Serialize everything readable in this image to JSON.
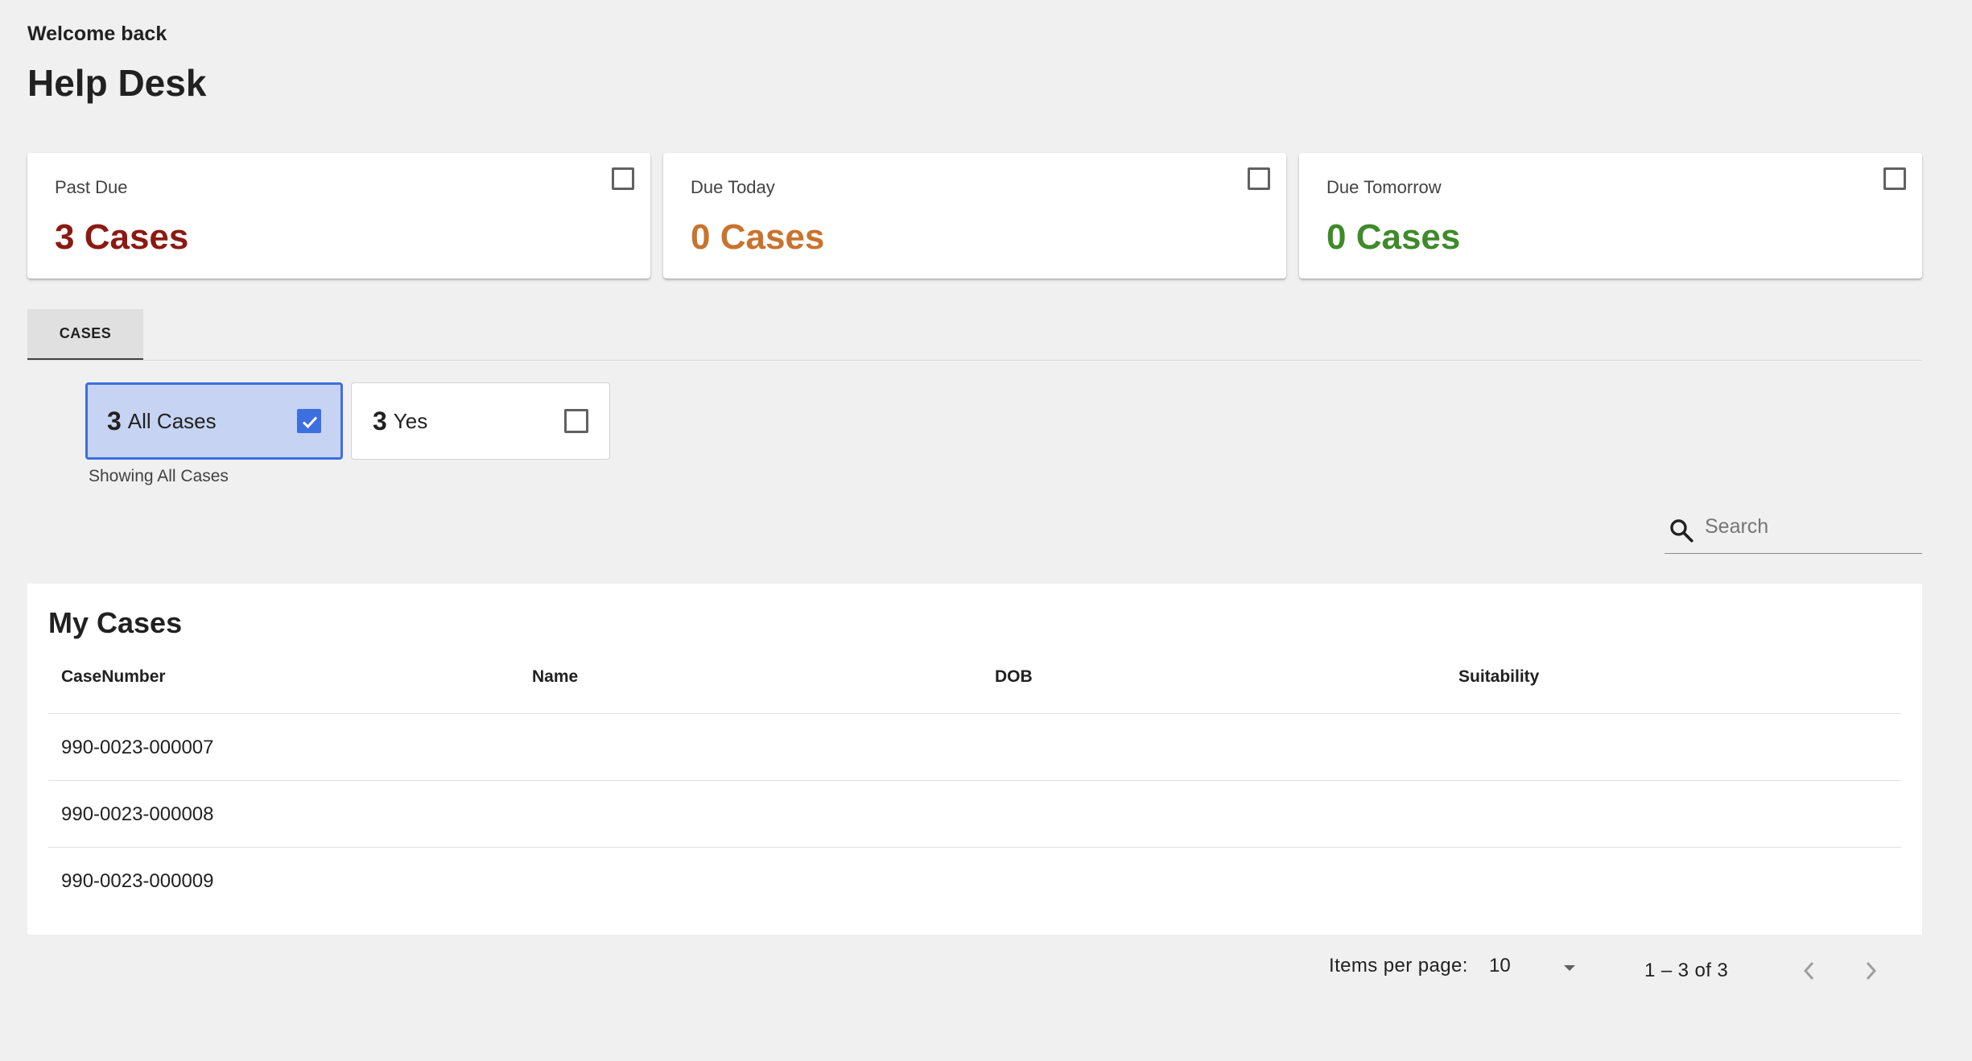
{
  "header": {
    "welcome": "Welcome back",
    "title": "Help Desk"
  },
  "summary_cards": [
    {
      "label": "Past Due",
      "count": "3 Cases",
      "color": "#8b1a12"
    },
    {
      "label": "Due Today",
      "count": "0 Cases",
      "color": "#c8732e"
    },
    {
      "label": "Due Tomorrow",
      "count": "0 Cases",
      "color": "#3f8a2a"
    }
  ],
  "tabs": [
    {
      "label": "CASES",
      "active": true
    }
  ],
  "filters": [
    {
      "count": "3",
      "label": "All Cases",
      "checked": true
    },
    {
      "count": "3",
      "label": "Yes",
      "checked": false
    }
  ],
  "filter_status": "Showing All Cases",
  "search": {
    "placeholder": "Search",
    "icon": "search-icon"
  },
  "cases_table": {
    "title": "My Cases",
    "columns": [
      "CaseNumber",
      "Name",
      "DOB",
      "Suitability"
    ],
    "rows": [
      {
        "case_number": "990-0023-000007",
        "name": "",
        "dob": "",
        "suitability": ""
      },
      {
        "case_number": "990-0023-000008",
        "name": "",
        "dob": "",
        "suitability": ""
      },
      {
        "case_number": "990-0023-000009",
        "name": "",
        "dob": "",
        "suitability": ""
      }
    ]
  },
  "paginator": {
    "items_per_page_label": "Items per page:",
    "items_per_page_value": "10",
    "range_label": "1 – 3 of 3"
  },
  "colors": {
    "accent": "#3c6fe0",
    "selected_chip_bg": "#c6d3f2",
    "page_bg": "#f0f0f0"
  }
}
